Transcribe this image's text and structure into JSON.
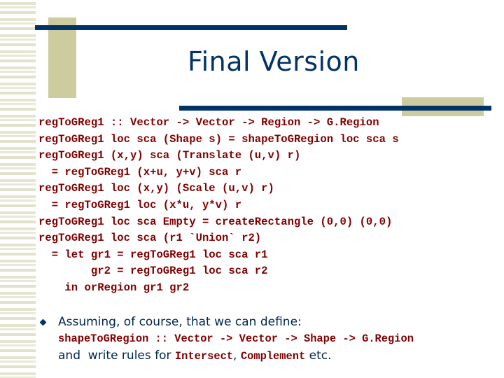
{
  "slide": {
    "title": "Final Version",
    "code_lines": [
      "regToGReg1 :: Vector -> Vector -> Region -> G.Region",
      "regToGReg1 loc sca (Shape s) = shapeToGRegion loc sca s",
      "regToGReg1 (x,y) sca (Translate (u,v) r)",
      "  = regToGReg1 (x+u, y+v) sca r",
      "regToGReg1 loc (x,y) (Scale (u,v) r)",
      "  = regToGReg1 loc (x*u, y*v) r",
      "regToGReg1 loc sca Empty = createRectangle (0,0) (0,0)",
      "regToGReg1 loc sca (r1 `Union` r2)",
      "  = let gr1 = regToGReg1 loc sca r1",
      "        gr2 = regToGReg1 loc sca r2",
      "    in orRegion gr1 gr2"
    ],
    "bullet": {
      "icon": "diamond-bullet-icon",
      "line1": "Assuming, of course, that we can define:",
      "line2_code": "shapeToGRegion :: Vector -> Vector -> Shape -> G.Region",
      "line3_prefix": "and  write rules for ",
      "line3_code1": "Intersect",
      "line3_sep": ", ",
      "line3_code2": "Complement",
      "line3_suffix": " etc."
    }
  },
  "colors": {
    "title": "#003366",
    "accent_bar": "#003366",
    "olive": "#cccc9e",
    "code": "#800000",
    "body_text": "#00264d"
  }
}
